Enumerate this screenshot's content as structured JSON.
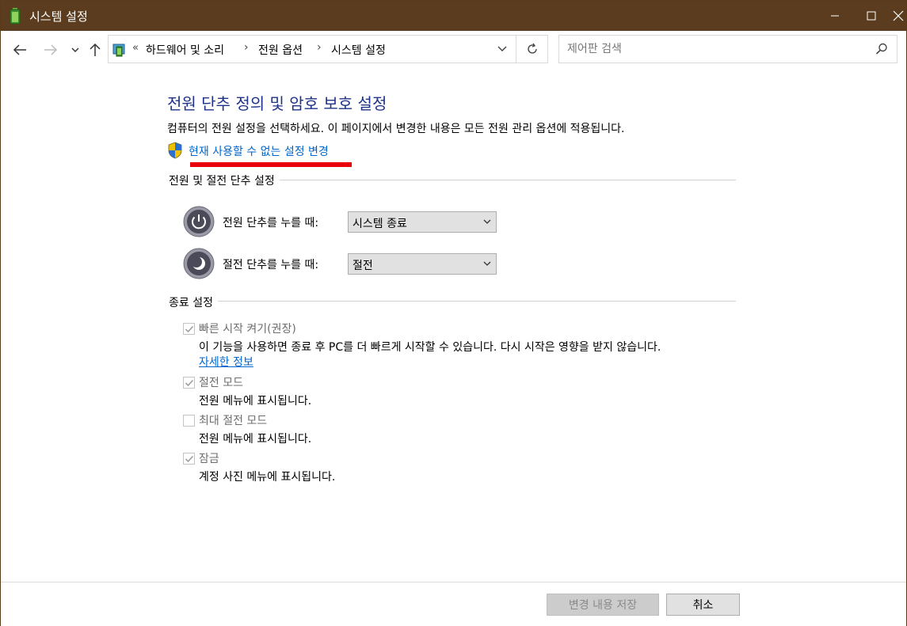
{
  "window": {
    "title": "시스템 설정"
  },
  "nav": {
    "back_icon": "arrow-left-icon",
    "forward_icon": "arrow-right-icon",
    "recent_icon": "chevron-down-icon",
    "up_icon": "arrow-up-icon"
  },
  "address": {
    "overflow": "«",
    "crumbs": [
      "하드웨어 및 소리",
      "전원 옵션",
      "시스템 설정"
    ]
  },
  "search": {
    "placeholder": "제어판 검색"
  },
  "main": {
    "heading": "전원 단추 정의 및 암호 보호 설정",
    "description": "컴퓨터의 전원 설정을 선택하세요. 이 페이지에서 변경한 내용은 모든 전원 관리 옵션에 적용됩니다.",
    "change_link": "현재 사용할 수 없는 설정 변경"
  },
  "power_section": {
    "title": "전원 및 절전 단추 설정",
    "rows": [
      {
        "label": "전원 단추를 누를 때:",
        "value": "시스템 종료"
      },
      {
        "label": "절전 단추를 누를 때:",
        "value": "절전"
      }
    ]
  },
  "shutdown_section": {
    "title": "종료 설정",
    "items": [
      {
        "label": "빠른 시작 켜기(권장)",
        "checked": true,
        "desc": "이 기능을 사용하면 종료 후 PC를 더 빠르게 시작할 수 있습니다. 다시 시작은 영향을 받지 않습니다.",
        "link": "자세한 정보"
      },
      {
        "label": "절전 모드",
        "checked": true,
        "desc": "전원 메뉴에 표시됩니다."
      },
      {
        "label": "최대 절전 모드",
        "checked": false,
        "desc": "전원 메뉴에 표시됩니다."
      },
      {
        "label": "잠금",
        "checked": true,
        "desc": "계정 사진 메뉴에 표시됩니다."
      }
    ]
  },
  "footer": {
    "save_label": "변경 내용 저장",
    "cancel_label": "취소"
  },
  "colors": {
    "titlebar": "#5c3c1e",
    "heading": "#1e3287",
    "link": "#0066cc",
    "annotation": "#e8000b"
  }
}
